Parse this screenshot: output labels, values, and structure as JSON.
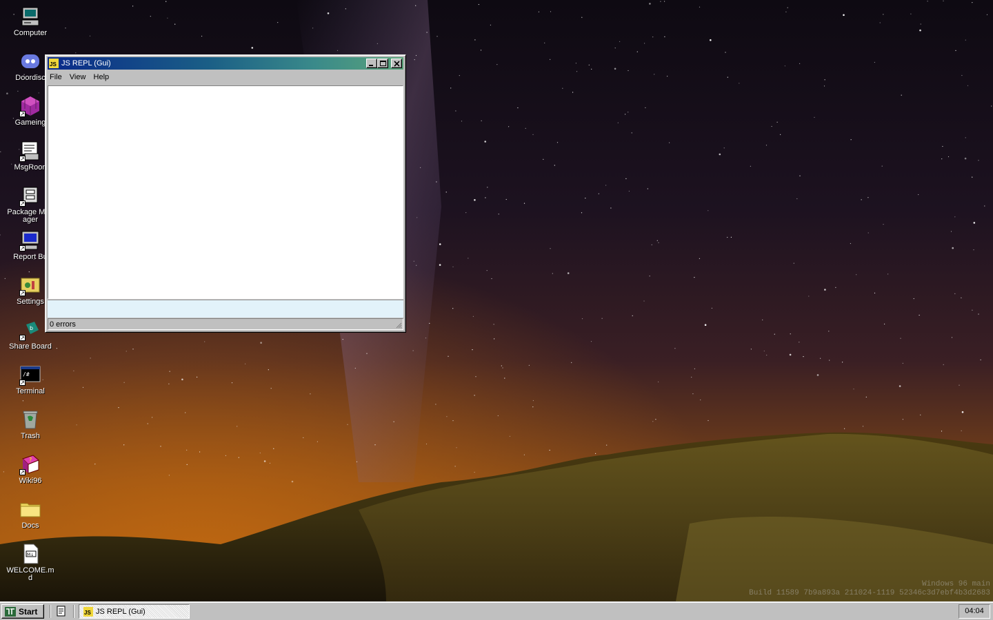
{
  "desktop": {
    "icons": [
      {
        "label": "Computer",
        "icon": "computer-icon",
        "shortcut": false
      },
      {
        "label": "Doordisc",
        "icon": "discord-icon",
        "shortcut": false
      },
      {
        "label": "Gameing",
        "icon": "game-cube-icon",
        "shortcut": true
      },
      {
        "label": "MsgRoon",
        "icon": "message-room-icon",
        "shortcut": true
      },
      {
        "label": "Package Manager",
        "icon": "package-manager-icon",
        "shortcut": true
      },
      {
        "label": "Report Bu",
        "icon": "report-bug-icon",
        "shortcut": true
      },
      {
        "label": "Settings",
        "icon": "settings-icon",
        "shortcut": true
      },
      {
        "label": "Share Board",
        "icon": "share-board-icon",
        "shortcut": true
      },
      {
        "label": "Terminal",
        "icon": "terminal-icon",
        "shortcut": true
      },
      {
        "label": "Trash",
        "icon": "trash-icon",
        "shortcut": false
      },
      {
        "label": "Wiki96",
        "icon": "wiki-book-icon",
        "shortcut": true
      },
      {
        "label": "Docs",
        "icon": "folder-icon",
        "shortcut": false
      },
      {
        "label": "WELCOME.md",
        "icon": "markdown-file-icon",
        "shortcut": false
      }
    ]
  },
  "window": {
    "title": "JS REPL (Gui)",
    "icon_text": "JS",
    "menu": [
      "File",
      "View",
      "Help"
    ],
    "editor_value": "",
    "console_value": "",
    "status": "0 errors"
  },
  "taskbar": {
    "start_label": "Start",
    "tasks": [
      {
        "label": "JS REPL (Gui)",
        "icon_text": "JS"
      }
    ],
    "clock": "04:04"
  },
  "watermark": {
    "line1": "Windows 96 main",
    "line2": "Build 11589 7b9a893a 211024-1119 52346c3d7ebf4b3d2683"
  },
  "colors": {
    "window_face": "#c0c0c0",
    "title_gradient_start": "#0a2a8a",
    "title_gradient_end": "#5aa37a",
    "console_bg": "#e2f2fa"
  }
}
